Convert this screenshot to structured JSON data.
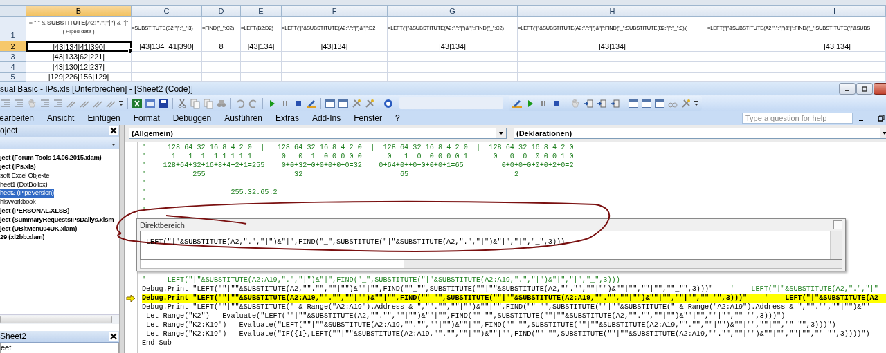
{
  "spreadsheet": {
    "columns": [
      {
        "label": "B",
        "selected": true
      },
      {
        "label": "C",
        "selected": false
      },
      {
        "label": "D",
        "selected": false
      },
      {
        "label": "E",
        "selected": false
      },
      {
        "label": "F",
        "selected": false
      },
      {
        "label": "G",
        "selected": false
      },
      {
        "label": "H",
        "selected": false
      },
      {
        "label": "I",
        "selected": false
      }
    ],
    "rows": [
      {
        "number": "1",
        "selected": false,
        "cells": [
          {
            "text": "= \"|\" & **SUBSTITUTE(**A2**;\".\";\"|\")** & \"|\"",
            "note": "( Piped data )",
            "selected": false
          },
          {
            "text": "=SUBSTITUTE(B2;\"|\";\"_\";3)",
            "selected": false
          },
          {
            "text": "=FIND(\"_\";C2)",
            "selected": false
          },
          {
            "text": "=LEFT(B2;D2)",
            "selected": false
          },
          {
            "text": "=LEFT(\"|\"&SUBSTITUTE(A2;\".\";\"|\")&\"|\";D2",
            "selected": false
          },
          {
            "text": "=LEFT(\"|\"&SUBSTITUTE(A2;\".\";\"|\")&\"|\";FIND(\"_\";C2)",
            "selected": false
          },
          {
            "text": "=LEFT(\"|\"&SUBSTITUTE(A2;\".\";\"|\")&\"|\";FIND(\"_\";SUBSTITUTE(B2;\"|\";\"_\";3)))",
            "selected": false
          },
          {
            "text": "=LEFT(\"|\"&SUBSTITUTE(A2;\".\";\"|\")&\"|\";FIND(\"_\";SUBSTITUTE(\"|\"&SUBS",
            "selected": false
          }
        ]
      },
      {
        "number": "2",
        "selected": true,
        "cells": [
          {
            "text": "|43|134|41|390|",
            "selected": true
          },
          {
            "text": "|43|134_41|390|",
            "selected": false
          },
          {
            "text": "8",
            "selected": false
          },
          {
            "text": "|43|134|",
            "selected": false
          },
          {
            "text": "|43|134|",
            "selected": false
          },
          {
            "text": "|43|134|",
            "selected": false
          },
          {
            "text": "|43|134|",
            "selected": false
          },
          {
            "text": "|43|134|",
            "selected": false
          }
        ]
      },
      {
        "number": "3",
        "selected": false,
        "cells": [
          {
            "text": "|43|133|62|221|",
            "selected": false
          },
          {
            "selected": false
          },
          {
            "selected": false
          },
          {
            "selected": false
          },
          {
            "selected": false
          },
          {
            "selected": false
          },
          {
            "selected": false
          },
          {
            "selected": false
          }
        ]
      },
      {
        "number": "4",
        "selected": false,
        "cells": [
          {
            "text": "|43|130|12|237|",
            "selected": false
          },
          {
            "selected": false
          },
          {
            "selected": false
          },
          {
            "selected": false
          },
          {
            "selected": false
          },
          {
            "selected": false
          },
          {
            "selected": false
          },
          {
            "selected": false
          }
        ]
      },
      {
        "number": "5",
        "selected": false,
        "cells": [
          {
            "text": "|129|226|156|129|",
            "selected": false
          },
          {
            "selected": false
          },
          {
            "selected": false
          },
          {
            "selected": false
          },
          {
            "selected": false
          },
          {
            "selected": false
          },
          {
            "selected": false
          },
          {
            "selected": false
          }
        ]
      }
    ]
  },
  "editor": {
    "title": "sual Basic - IPs.xls [Unterbrechen] - [Sheet2 (Code)]",
    "menu": [
      "earbeiten",
      "Ansicht",
      "Einfügen",
      "Format",
      "Debuggen",
      "Ausführen",
      "Extras",
      "Add-Ins",
      "Fenster",
      "?"
    ],
    "help_box": {
      "placeholder": "Type a question for help"
    },
    "project": {
      "title": "oject",
      "items": [
        {
          "label": "ject (Forum Tools 14.06.2015.xlam)",
          "kind": "project",
          "selected": false
        },
        {
          "label": "ject (IPs.xls)",
          "kind": "project",
          "selected": false,
          "children": [
            {
              "label": "soft Excel Objekte",
              "kind": "component",
              "selected": false,
              "children": [
                {
                  "label": "heet1 (DotBollox)",
                  "kind": "component",
                  "selected": false
                },
                {
                  "label": "heet2 (PipeVersion)",
                  "kind": "component",
                  "selected": true
                },
                {
                  "label": "hisWorkbook",
                  "kind": "component",
                  "selected": false
                }
              ]
            }
          ]
        },
        {
          "label": "ject (PERSONAL.XLSB)",
          "kind": "project",
          "selected": false
        },
        {
          "label": "ject (SummaryRequestsIPsDailys.xlsm",
          "kind": "project",
          "selected": false
        },
        {
          "label": "ject (UBitMenu04UK.xlam)",
          "kind": "project",
          "selected": false
        },
        {
          "label": "29 (xl2bb.xlam)",
          "kind": "project",
          "selected": false
        }
      ]
    },
    "properties": {
      "title": "Sheet2",
      "dropdown": "eet"
    },
    "code": {
      "object_dropdown": "(Allgemein)",
      "procedure_dropdown": "(Deklarationen)",
      "lines_above": [
        {
          "kind": "comment",
          "text": "'     128 64 32 16 8 4 2 0  |   128 64 32 16 8 4 2 0  |  128 64 32 16 8 4 2 0  |  128 64 32 16 8 4 2 0"
        },
        {
          "kind": "comment",
          "text": "'      1   1  1  1 1 1 1 1       0   0  1  0 0 0 0 0      0   1  0  0 0 0 0 1      0   0  0  0 0 0 1 0"
        },
        {
          "kind": "comment",
          "text": "'    128+64+32+16+8+4+2+1=255    0+0+32+0+0+0+0+0=32    0+64+0++0+0+0+0+1=65         0+0+0+0+0+0+2+0=2"
        },
        {
          "kind": "comment",
          "text": "'           255                     32                       65                         2"
        },
        {
          "kind": "comment",
          "text": "'"
        },
        {
          "kind": "comment",
          "text": "'                    255.32.65.2"
        },
        {
          "kind": "comment",
          "text": "'"
        },
        {
          "kind": "comment",
          "text": "'"
        }
      ],
      "immediate": {
        "title": "Direktbereich",
        "text": "LEFT(\"|\"&SUBSTITUTE(A2,\".\",\"|\")&\"|\",FIND(\"_\",SUBSTITUTE(\"|\"&SUBSTITUTE(A2,\".\",\"|\")&\"|\",\"|\",\"_\",3)))"
      },
      "lines_below": [
        {
          "kind": "comment",
          "text": "'    =LEFT(\"|\"&SUBSTITUTE(A2:A19,\".\",\"|\")&\"|\",FIND(\"_\",SUBSTITUTE(\"|\"&SUBSTITUTE(A2:A19,\".\",\"|\")&\"|\",\"|\",\"_\",3)))"
        },
        {
          "kind": "code",
          "text": "Debug.Print \"LEFT(\"\"|\"\"&SUBSTITUTE(A2,\"\".\"\",\"\"|\"\")&\"\"|\"\",FIND(\"\"_\"\",SUBSTITUTE(\"\"|\"\"&SUBSTITUTE(A2,\"\".\"\",\"\"|\"\")&\"\"|\"\",\"\"|\"\",\"\"_\"\",3)))\"",
          "comment": "    '    LEFT(\"|\"&SUBSTITUTE(A2,\".\",\"|\""
        },
        {
          "kind": "current",
          "text": "Debug.Print \"LEFT(\"\"|\"\"&SUBSTITUTE(A2:A19,\"\".\"\",\"\"|\"\")&\"\"|\"\",FIND(\"\"_\"\",SUBSTITUTE(\"\"|\"\"&SUBSTITUTE(A2:A19,\"\".\"\",\"\"|\"\")&\"\"|\"\",\"\"|\"\",\"\"_\"\",3)))\"",
          "comment": "    '    LEFT(\"|\"&SUBSTITUTE(A2"
        },
        {
          "kind": "code",
          "text": "Debug.Print \"LEFT(\"\"|\"\"&SUBSTITUTE(\" & Range(\"A2:A19\").Address & \",\"\".\"\",\"\"|\"\")&\"\"|\"\",FIND(\"\"_\"\",SUBSTITUTE(\"\"|\"\"&SUBSTITUTE(\" & Range(\"A2:A19\").Address & \",\"\".\"\",\"\"|\"\")&\"\""
        },
        {
          "kind": "code",
          "text": " Let Range(\"K2\") = Evaluate(\"LEFT(\"\"|\"\"&SUBSTITUTE(A2,\"\".\"\",\"\"|\"\")&\"\"|\"\",FIND(\"\"_\"\",SUBSTITUTE(\"\"|\"\"&SUBSTITUTE(A2,\"\".\"\",\"\"|\"\")&\"\"|\"\",\"\"|\"\",\"\"_\"\",3)))\")"
        },
        {
          "kind": "code",
          "text": " Let Range(\"K2:K19\") = Evaluate(\"LEFT(\"\"|\"\"&SUBSTITUTE(A2:A19,\"\".\"\",\"\"|\"\")&\"\"|\"\",FIND(\"\"_\"\",SUBSTITUTE(\"\"|\"\"&SUBSTITUTE(A2:A19,\"\".\"\",\"\"|\"\")&\"\"|\"\",\"\"|\"\",\"\"_\"\",3)))\")"
        },
        {
          "kind": "code",
          "text": " Let Range(\"K2:K19\") = Evaluate(\"IF({1},LEFT(\"\"|\"\"&SUBSTITUTE(A2:A19,\"\".\"\",\"\"|\"\")&\"\"|\"\",FIND(\"\"_\"\",SUBSTITUTE(\"\"|\"\"&SUBSTITUTE(A2:A19,\"\".\"\",\"\"|\"\")&\"\"|\"\",\"\"|\"\",\"\"_\"\",3))))\")"
        },
        {
          "kind": "code",
          "text": "End Sub"
        }
      ]
    }
  }
}
